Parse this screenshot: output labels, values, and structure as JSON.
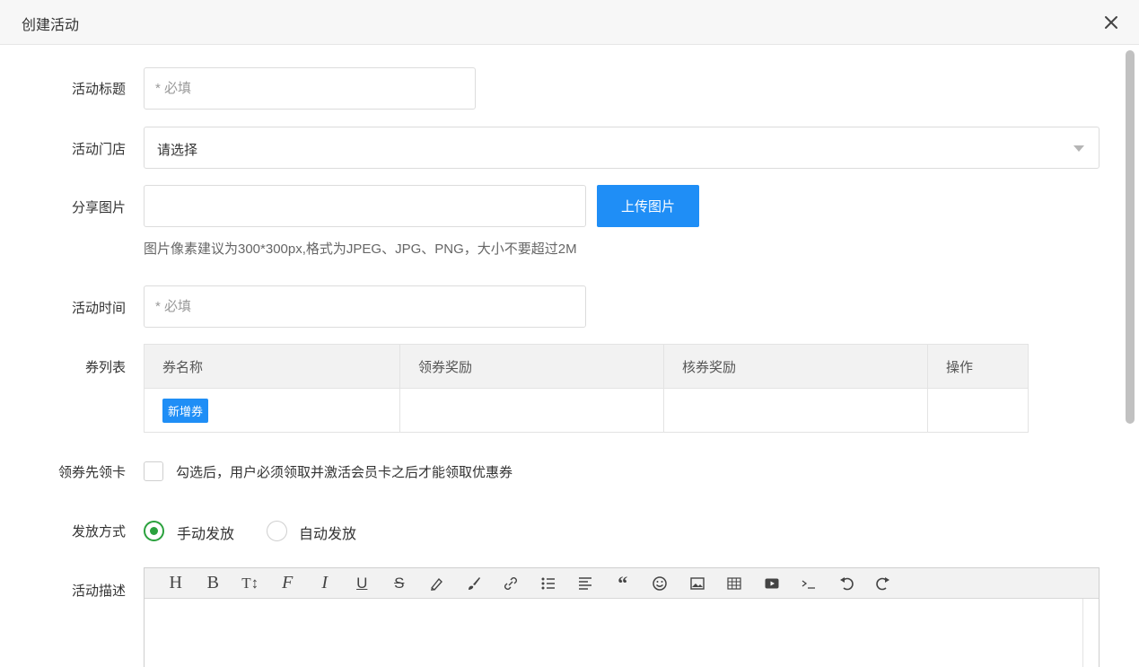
{
  "dialog": {
    "title": "创建活动"
  },
  "form": {
    "title": {
      "label": "活动标题",
      "placeholder": "* 必填"
    },
    "store": {
      "label": "活动门店",
      "value": "请选择"
    },
    "share_image": {
      "label": "分享图片",
      "button": "上传图片",
      "hint": "图片像素建议为300*300px,格式为JPEG、JPG、PNG，大小不要超过2M"
    },
    "time": {
      "label": "活动时间",
      "placeholder": "* 必填"
    },
    "coupons": {
      "label": "券列表",
      "columns": [
        "券名称",
        "领券奖励",
        "核券奖励",
        "操作"
      ],
      "add_button": "新增券"
    },
    "card_first": {
      "label": "领券先领卡",
      "text": "勾选后，用户必须领取并激活会员卡之后才能领取优惠券",
      "checked": false
    },
    "dispatch": {
      "label": "发放方式",
      "options": [
        {
          "label": "手动发放",
          "checked": true
        },
        {
          "label": "自动发放",
          "checked": false
        }
      ]
    },
    "description": {
      "label": "活动描述",
      "toolbar": [
        {
          "name": "heading-icon",
          "glyph": "H"
        },
        {
          "name": "bold-icon",
          "glyph": "B"
        },
        {
          "name": "text-size-icon",
          "glyph": "T↕"
        },
        {
          "name": "font-icon",
          "glyph": "ℱ"
        },
        {
          "name": "italic-icon",
          "glyph": "I"
        },
        {
          "name": "underline-icon",
          "glyph": "U"
        },
        {
          "name": "strikethrough-icon",
          "glyph": "S"
        },
        {
          "name": "highlight-icon",
          "glyph": ""
        },
        {
          "name": "brush-icon",
          "glyph": ""
        },
        {
          "name": "link-icon",
          "glyph": ""
        },
        {
          "name": "bullet-list-icon",
          "glyph": ""
        },
        {
          "name": "align-icon",
          "glyph": ""
        },
        {
          "name": "quote-icon",
          "glyph": "❝"
        },
        {
          "name": "emoji-icon",
          "glyph": "☺"
        },
        {
          "name": "image-icon",
          "glyph": ""
        },
        {
          "name": "table-icon",
          "glyph": ""
        },
        {
          "name": "video-icon",
          "glyph": ""
        },
        {
          "name": "code-icon",
          "glyph": "›_"
        },
        {
          "name": "undo-icon",
          "glyph": "↶"
        },
        {
          "name": "redo-icon",
          "glyph": "↷"
        }
      ]
    }
  },
  "colors": {
    "primary": "#1f8ef6",
    "radio_checked": "#2aa13d"
  }
}
